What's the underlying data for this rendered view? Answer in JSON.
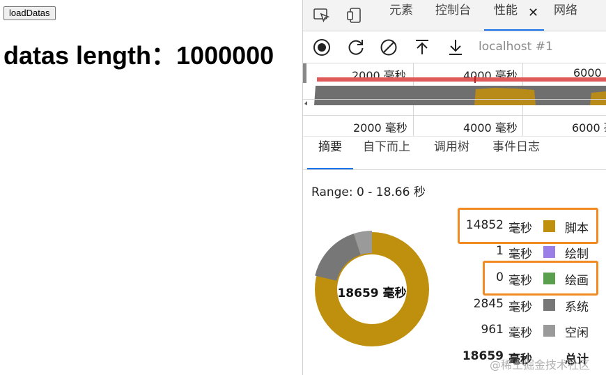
{
  "page": {
    "button_label": "loadDatas",
    "heading": "datas length：1000000"
  },
  "devtools": {
    "tabs": [
      "元素",
      "控制台",
      "性能",
      "网络"
    ],
    "active_tab": "性能",
    "close_glyph": "✕",
    "toolbar": {
      "target": "localhost #1",
      "icons": [
        "record-icon",
        "reload-icon",
        "clear-icon",
        "upload-icon",
        "download-icon"
      ]
    },
    "overview": {
      "top_ticks": [
        "2000 毫秒",
        "4000 毫秒",
        "6000"
      ],
      "bottom_ticks": [
        "2000 毫秒",
        "4000 毫秒",
        "6000 毫秒"
      ]
    },
    "summary_tabs": [
      "摘要",
      "自下而上",
      "调用树",
      "事件日志"
    ],
    "range": "Range: 0 - 18.66 秒",
    "donut_total": "18659 毫秒",
    "legend": [
      {
        "value": "14852",
        "unit": "毫秒",
        "name": "脚本",
        "color": "#bf8f0e",
        "highlighted": true
      },
      {
        "value": "1",
        "unit": "毫秒",
        "name": "绘制",
        "color": "#9b7fe6",
        "highlighted": false
      },
      {
        "value": "0",
        "unit": "毫秒",
        "name": "绘画",
        "color": "#5a9f4d",
        "highlighted": true
      },
      {
        "value": "2845",
        "unit": "毫秒",
        "name": "系统",
        "color": "#777777",
        "highlighted": false
      },
      {
        "value": "961",
        "unit": "毫秒",
        "name": "空闲",
        "color": "#9a9a9a",
        "highlighted": false
      }
    ],
    "total": {
      "value": "18659",
      "unit": "毫秒",
      "name": "总计"
    },
    "watermark": "@稀土掘金技术社区"
  },
  "colors": {
    "accent": "#1a73e8",
    "highlight": "#f28a22",
    "cpu_bar": "#e05a5a",
    "scripting": "#bf8f0e"
  }
}
